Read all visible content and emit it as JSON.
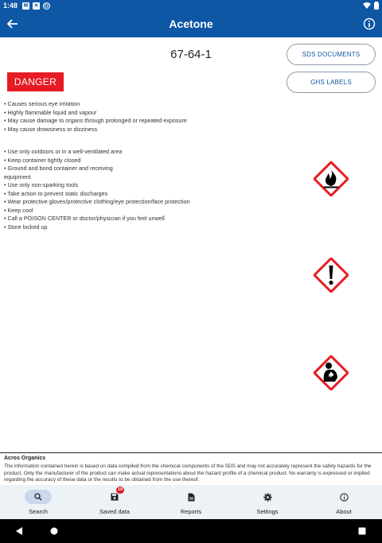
{
  "status_bar": {
    "time": "1:48",
    "left_icons": [
      "mail-icon",
      "x-notification-icon",
      "at-sign-icon"
    ],
    "right_icons": [
      "wifi-icon",
      "battery-icon"
    ]
  },
  "app_bar": {
    "title": "Acetone",
    "background": "#0d57a5"
  },
  "product": {
    "cas_number": "67-64-1",
    "signal_word": "DANGER",
    "signal_color": "#e61b23"
  },
  "buttons": {
    "sds_documents": "SDS DOCUMENTS",
    "ghs_labels": "GHS LABELS"
  },
  "hazard_statements": [
    "• Causes serious eye irritation",
    "• Highly flammable liquid and vapour",
    "• May cause damage to organs through prolonged or repeated exposure",
    "• May cause drowsiness or dizziness"
  ],
  "precautionary_statements": [
    "• Use only outdoors or in a well-ventilated area",
    "• Keep container tightly closed",
    "• Ground and bond container and receiving",
    "equipment",
    "• Use only non-sparking tools",
    "• Take action to prevent static discharges",
    "• Wear protective gloves/protective clothing/eye protection/face protection",
    "• Keep cool",
    "• Call a POISON CENTER or doctor/physician if you feel unwell",
    "• Store locked up"
  ],
  "pictograms": [
    "flame-pictogram-icon",
    "exclamation-pictogram-icon",
    "health-hazard-pictogram-icon"
  ],
  "footer": {
    "supplier": "Acros Organics",
    "disclaimer": "The information contained herein is based on data compiled from the chemical components of the SDS and may not accurately represent the safety hazards for the product. Only the manufacturer of the product can make actual representations about the hazard profile of a chemical product. No warranty is expressed or implied regarding the accuracy of these data or the results to be obtained from the use thereof."
  },
  "bottom_nav": {
    "items": [
      {
        "label": "Search",
        "icon": "search-icon",
        "active": true
      },
      {
        "label": "Saved data",
        "icon": "save-icon",
        "badge": "19"
      },
      {
        "label": "Reports",
        "icon": "document-icon"
      },
      {
        "label": "Settings",
        "icon": "gear-icon"
      },
      {
        "label": "About",
        "icon": "info-icon"
      }
    ]
  }
}
